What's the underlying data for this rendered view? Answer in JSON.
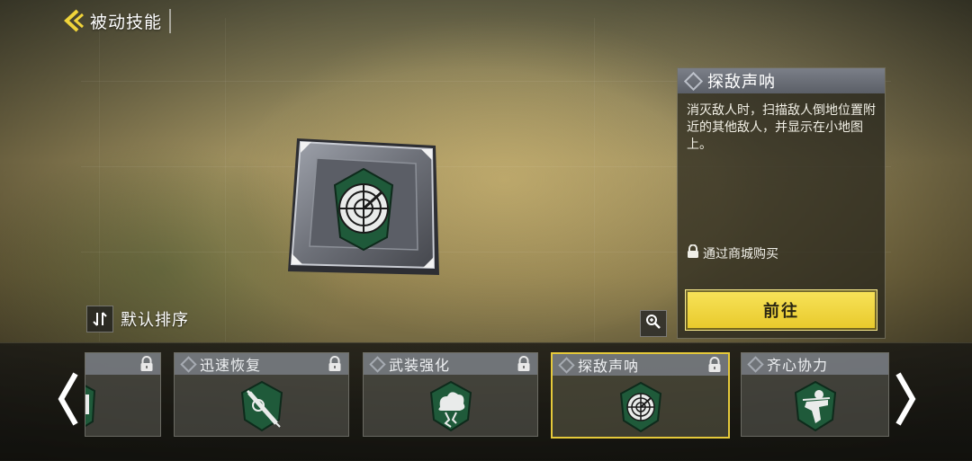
{
  "header": {
    "title": "被动技能",
    "back_icon": "back-arrow-icon"
  },
  "colors": {
    "accent_yellow": "#f0d43a",
    "perk_green": "#1f5a3a",
    "panel_bg": "#26241c"
  },
  "detail_panel": {
    "title": "探敌声呐",
    "description": "消灭敌人时，扫描敌人倒地位置附近的其他敌人，并显示在小地图上。",
    "unlock_text": "通过商城购买",
    "go_button": "前往"
  },
  "sort": {
    "label": "默认排序",
    "icon": "sort-icon"
  },
  "zoom": {
    "icon": "zoom-in-icon"
  },
  "perks": [
    {
      "name": "",
      "icon": "partial-perk-icon",
      "locked": true,
      "selected": false
    },
    {
      "name": "迅速恢复",
      "icon": "syringe-icon",
      "locked": true,
      "selected": false
    },
    {
      "name": "武装强化",
      "icon": "armor-burst-icon",
      "locked": true,
      "selected": false
    },
    {
      "name": "探敌声呐",
      "icon": "radar-icon",
      "locked": true,
      "selected": true
    },
    {
      "name": "齐心协力",
      "icon": "soldier-icon",
      "locked": false,
      "selected": false
    }
  ]
}
